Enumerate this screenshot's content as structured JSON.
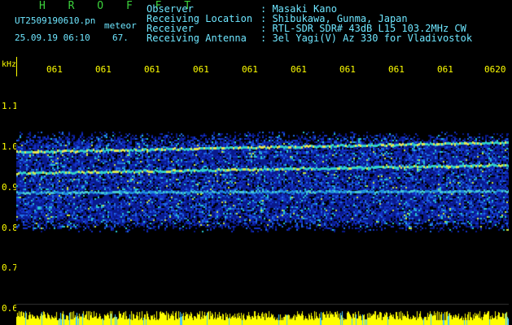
{
  "header": {
    "title": "H R O F F T",
    "filename": "UT2509190610.pn",
    "meteor_label": "meteor",
    "datetime": "25.09.19 06:10",
    "count": "67."
  },
  "meta": {
    "observer_label": "Observer",
    "observer_value": ": Masaki Kano",
    "location_label": "Receiving Location",
    "location_value": ": Shibukawa, Gunma, Japan",
    "receiver_label": "Receiver",
    "receiver_value": ": RTL-SDR SDR# 43dB L15 103.2MHz CW",
    "antenna_label": "Receiving Antenna",
    "antenna_value": ": 3el Yagi(V) Az 330 for Vladivostok"
  },
  "axis": {
    "y_unit": "kHz",
    "y_ticks": [
      "1.1",
      "1.0",
      "0.9",
      "0.8",
      "0.7",
      "0.6"
    ],
    "x_ticks": [
      "061",
      "061",
      "061",
      "061",
      "061",
      "061",
      "061",
      "061",
      "061",
      "0620"
    ]
  },
  "colors": {
    "background": "#000000",
    "text_green": "#3cd23c",
    "text_cyan": "#6ee6ff",
    "axis_yellow": "#ffff00"
  }
}
